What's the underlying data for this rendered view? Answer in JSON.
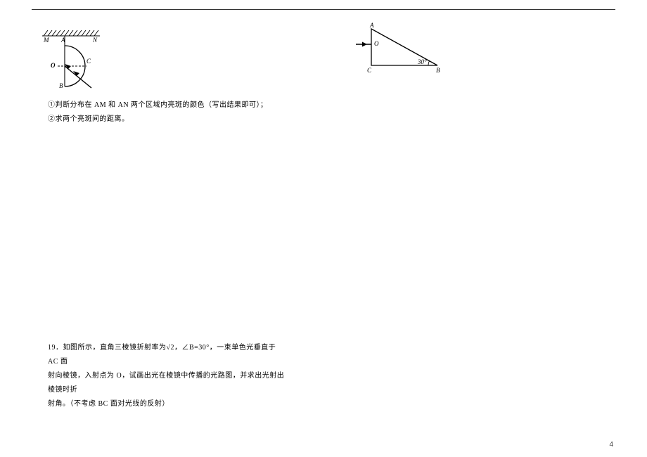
{
  "page_number": "4",
  "fig1": {
    "M": "M",
    "A": "A",
    "N": "N",
    "C": "C",
    "O": "O",
    "B": "B"
  },
  "fig2": {
    "A": "A",
    "B": "B",
    "C": "C",
    "O": "O",
    "angle": "30°"
  },
  "text": {
    "line1": "①判断分布在 AM 和 AN 两个区域内亮斑的颜色（写出结果即可）；",
    "line2": "②求两个亮斑间的距离。",
    "q19_l1_pre": "19．如图所示，直角三棱镜折射率为",
    "q19_sqrt": "√2",
    "q19_l1_post": "，∠B=30°，一束单色光垂直于 AC 面",
    "q19_l2": "射向棱镜，入射点为 O，试画出光在棱镜中传播的光路图，并求出光射出棱镜时折",
    "q19_l3": "射角。（不考虑 BC 面对光线的反射）"
  }
}
